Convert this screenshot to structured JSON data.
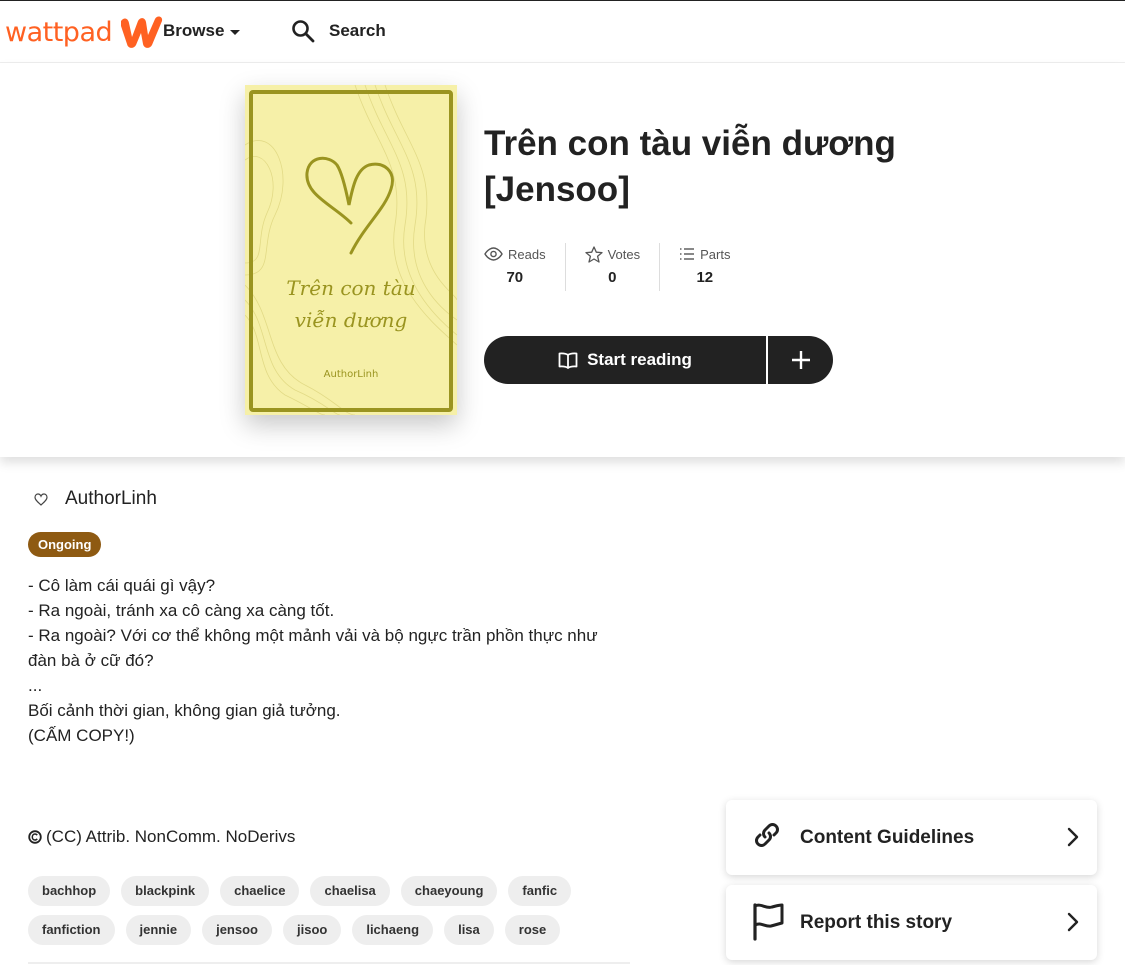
{
  "nav": {
    "logo_text": "wattpad",
    "browse_label": "Browse",
    "search_label": "Search"
  },
  "story": {
    "title": "Trên con tàu viễn dương [Jensoo]",
    "cover": {
      "title_line1": "Trên con tàu",
      "title_line2": "viễn dương",
      "author": "AuthorLinh"
    },
    "stats": [
      {
        "label": "Reads",
        "value": "70",
        "icon": "eye-icon"
      },
      {
        "label": "Votes",
        "value": "0",
        "icon": "star-icon"
      },
      {
        "label": "Parts",
        "value": "12",
        "icon": "list-icon"
      }
    ],
    "start_reading_label": "Start reading",
    "author": "AuthorLinh",
    "status": "Ongoing",
    "description": [
      "- Cô làm cái quái gì vậy?",
      "- Ra ngoài, tránh xa cô càng xa càng tốt.",
      "- Ra ngoài? Với cơ thể không một mảnh vải và bộ ngực trần phồn thực như đàn bà ở cữ đó?",
      "",
      "...",
      "",
      "Bối cảnh thời gian, không gian giả tưởng.",
      "(CẤM COPY!)"
    ],
    "license": "(CC) Attrib. NonComm. NoDerivs",
    "tags": [
      "bachhop",
      "blackpink",
      "chaelice",
      "chaelisa",
      "chaeyoung",
      "fanfic",
      "fanfiction",
      "jennie",
      "jensoo",
      "jisoo",
      "lichaeng",
      "lisa",
      "rose"
    ]
  },
  "side": {
    "content_guidelines_label": "Content Guidelines",
    "report_label": "Report this story"
  },
  "colors": {
    "brand": "#ff6122",
    "status_badge": "#8e5a12",
    "button_dark": "#222222",
    "cover_bg": "#f6f0a8",
    "cover_ink": "#9a9420"
  }
}
